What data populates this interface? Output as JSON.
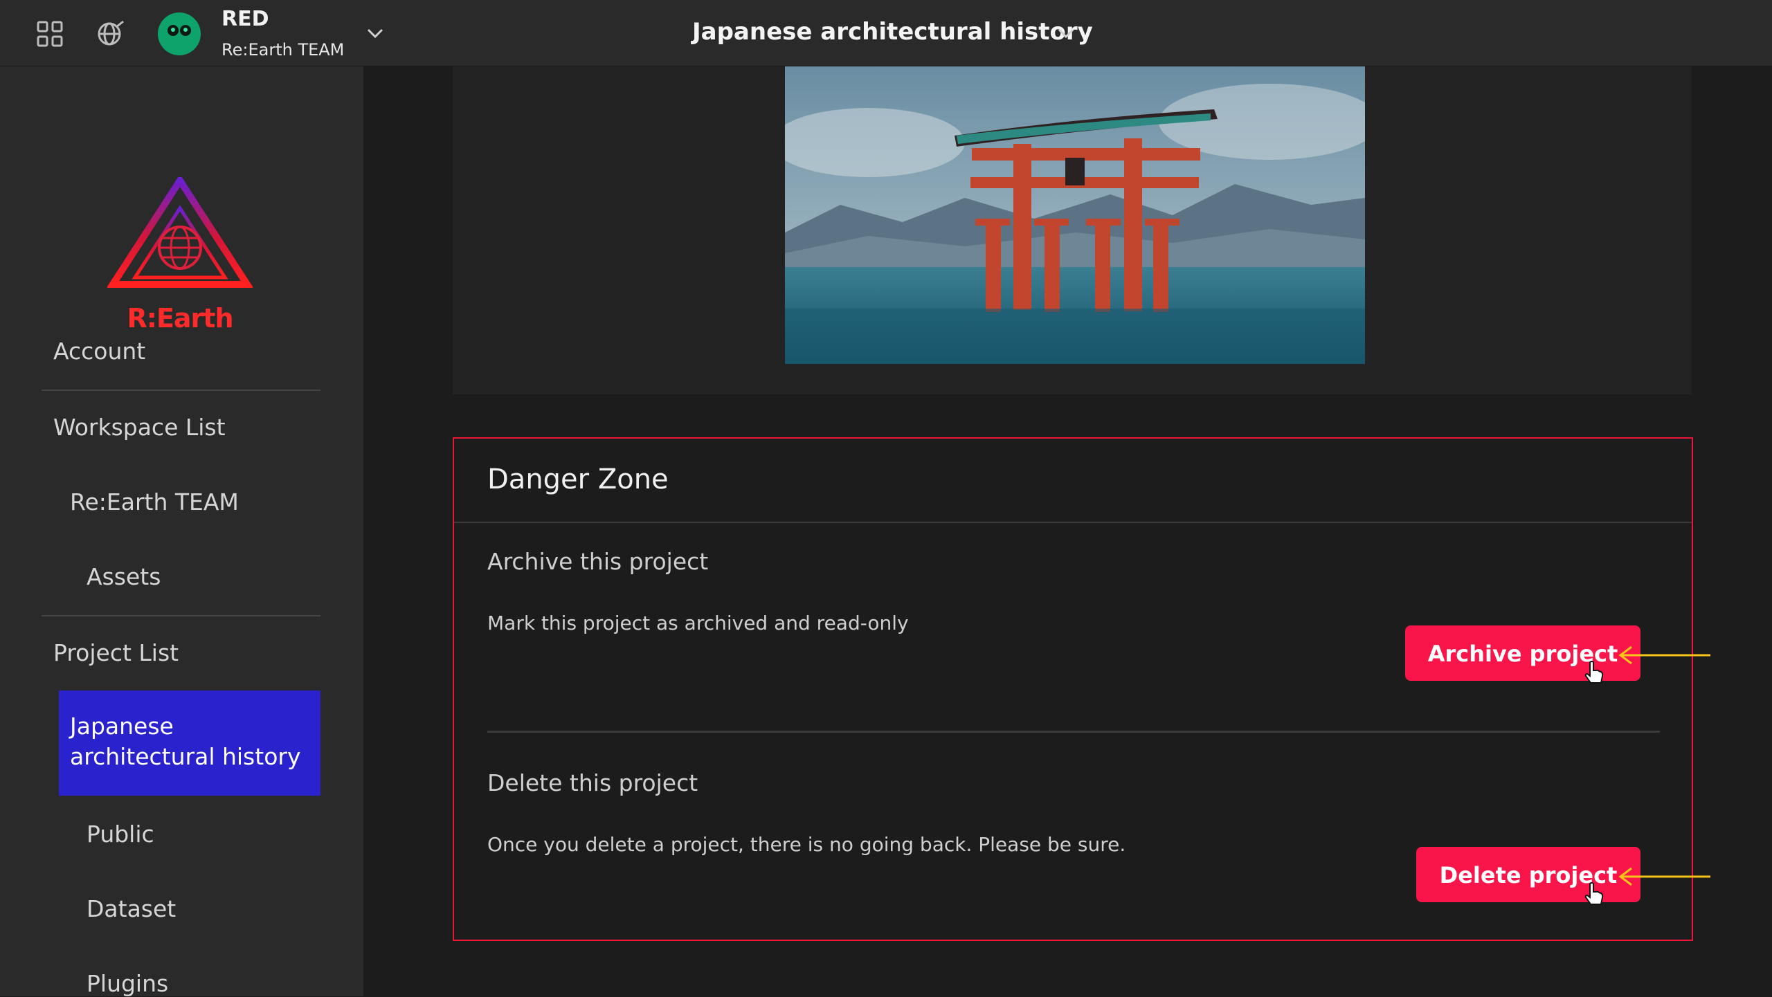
{
  "header": {
    "user_name": "RED",
    "team_name": "Re:Earth TEAM",
    "project_title": "Japanese architectural history"
  },
  "sidebar": {
    "logo_text": "R:Earth",
    "items": [
      {
        "label": "Account"
      },
      {
        "label": "Workspace List"
      },
      {
        "label": "Re:Earth TEAM"
      },
      {
        "label": "Assets"
      },
      {
        "label": "Project List"
      },
      {
        "label": "Japanese architectural history"
      },
      {
        "label": "Public"
      },
      {
        "label": "Dataset"
      },
      {
        "label": "Plugins"
      }
    ]
  },
  "danger_zone": {
    "title": "Danger Zone",
    "archive": {
      "title": "Archive this project",
      "description": "Mark this project as archived and read-only",
      "button_label": "Archive project"
    },
    "delete": {
      "title": "Delete this project",
      "description": "Once you delete a project, there is no going back. Please be sure.",
      "button_label": "Delete project"
    }
  },
  "colors": {
    "accent_red": "#f9154a",
    "danger_border": "#e8173a",
    "active_nav": "#2a22cc",
    "annotation_arrow": "#f5c518"
  },
  "icons": [
    "apps-grid-icon",
    "globe-edit-icon",
    "avatar-icon",
    "chevron-down-icon",
    "reearth-logo-icon",
    "arrow-left-icon",
    "hand-cursor-icon"
  ]
}
